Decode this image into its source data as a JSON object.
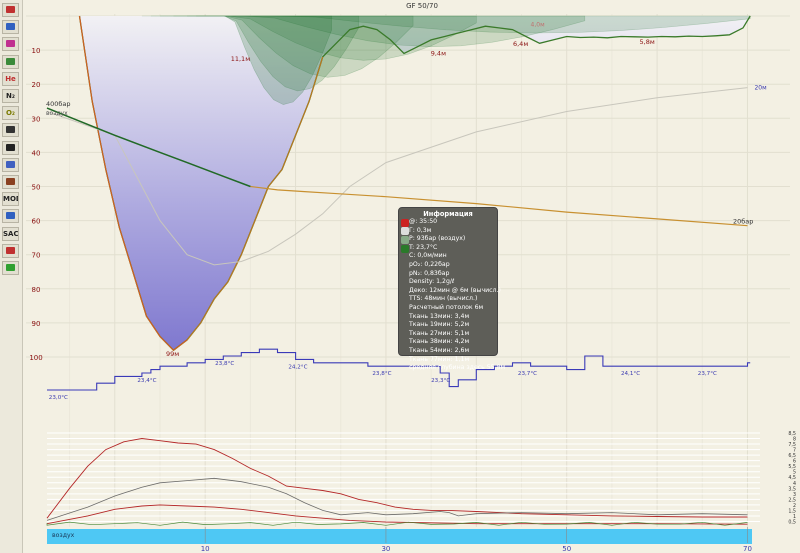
{
  "title": "GF 50/70",
  "toolbar": {
    "buttons": [
      {
        "icon": "profile-icon",
        "text": ""
      },
      {
        "icon": "ceiling-icon",
        "text": ""
      },
      {
        "icon": "ceiling-calc-icon",
        "text": ""
      },
      {
        "icon": "tissues-icon",
        "text": ""
      },
      {
        "icon": "he-icon",
        "text": "He"
      },
      {
        "icon": "n2-icon",
        "text": "N₂"
      },
      {
        "icon": "o2-icon",
        "text": "O₂"
      },
      {
        "icon": "scale-icon",
        "text": ""
      },
      {
        "icon": "heartrate-icon",
        "text": ""
      },
      {
        "icon": "ppgraph-icon",
        "text": ""
      },
      {
        "icon": "events-icon",
        "text": ""
      },
      {
        "icon": "mod-icon",
        "text": "MOD"
      },
      {
        "icon": "ead-icon",
        "text": ""
      },
      {
        "icon": "sac-icon",
        "text": "SAC"
      },
      {
        "icon": "heart-icon",
        "text": ""
      },
      {
        "icon": "color-icon",
        "text": ""
      }
    ]
  },
  "info_box": {
    "title": "Информация",
    "lines": [
      "@: 35:50",
      "Г: 0,3м",
      "P: 93бар (воздух)",
      "T: 23,7°C",
      "С: 0,0м/мин",
      "pO₂: 0,22бар",
      "pN₂: 0,83бар",
      "Density: 1,2g/ℓ",
      "Деко: 12мин @ 6м (вычисл.)",
      "TTS: 48мин (вычисл.)",
      "Расчетный потолок 6м",
      "Ткань 13мин: 3,4м",
      "Ткань 19мин: 5,2м",
      "Ткань 27мин: 5,1м",
      "Ткань 38мин: 4,2м",
      "Ткань 54мин: 2,6м",
      "Ткань 77мин: 1,1м",
      "средняя глубина здесь 55,8м"
    ]
  },
  "chart_data": {
    "type": "area",
    "title": "GF 50/70",
    "x_unit": "min",
    "xlim": [
      -7.5,
      70.5
    ],
    "x_ticks": [
      10,
      30,
      50,
      70
    ],
    "y_ticks": [
      10,
      20,
      30,
      40,
      50,
      60,
      70,
      80,
      90,
      100
    ],
    "ylim_depth_m": [
      -2,
      113
    ],
    "depth_profile": {
      "time_min": [
        -3.9,
        -2.5,
        -1,
        0.5,
        2,
        3.5,
        5,
        6.5,
        8,
        9.5,
        11,
        12.5,
        14,
        15.5,
        17,
        18.5,
        20,
        21.5,
        23,
        24.5,
        26,
        27.5,
        29,
        30.5,
        32,
        33.5,
        35,
        36.5,
        38,
        39.5,
        41,
        42.5,
        44,
        45.5,
        47,
        48.5,
        50,
        51.5,
        53,
        54.5,
        56,
        57.5,
        59,
        60.5,
        62,
        63.5,
        65,
        66.5,
        68,
        69.5,
        70.3
      ],
      "depth_m": [
        0,
        25,
        45,
        62,
        75,
        88,
        94,
        98,
        95,
        90,
        83,
        78,
        70,
        60,
        50,
        45,
        35,
        25,
        12,
        8,
        4,
        3,
        4,
        7,
        11,
        9,
        7,
        6,
        5,
        4,
        3,
        3.5,
        4,
        6,
        8,
        7,
        6,
        6.3,
        6.2,
        6.4,
        6,
        6.1,
        6.2,
        6.0,
        6.1,
        5.9,
        6.0,
        5.8,
        5.5,
        3.5,
        0
      ]
    },
    "depth_labels": [
      {
        "t": 6.4,
        "d": 98,
        "text": "99м"
      },
      {
        "t": 13.9,
        "d": 11.5,
        "text": "11,1м"
      },
      {
        "t": 35.8,
        "d": 9.8,
        "text": "9,4м"
      },
      {
        "t": 44.9,
        "d": 7,
        "text": "6,4м"
      },
      {
        "t": 58.9,
        "d": 6.5,
        "text": "5,8м"
      }
    ],
    "ceiling_note": {
      "t": 46,
      "d": 4,
      "text": "4,0м"
    },
    "pressure_start": {
      "value_bar": 400,
      "label": "400бар",
      "gas": "воздух"
    },
    "pressure_end": {
      "value_bar": 20,
      "label": "20бар"
    },
    "pressure_curve": {
      "time_min": [
        -7.5,
        0,
        5,
        8,
        12,
        15,
        18,
        21,
        24,
        30,
        40,
        50,
        60,
        70
      ],
      "depth_equiv": [
        27,
        35,
        40,
        43,
        47,
        50,
        51,
        51.5,
        52,
        53,
        55,
        57.5,
        59.5,
        61.5
      ]
    },
    "gf_line": {
      "label": "20м",
      "time_min": [
        -7.5,
        0,
        5,
        8,
        11,
        14,
        17,
        20,
        23,
        26,
        30,
        40,
        50,
        60,
        70
      ],
      "depth_equiv": [
        28,
        35,
        60,
        70,
        73,
        72,
        69,
        64,
        58,
        50,
        43,
        34,
        28,
        24,
        21
      ]
    },
    "temperature": {
      "time_min": [
        -7.5,
        -4,
        -2,
        0,
        1,
        3,
        4,
        5,
        6,
        8,
        10,
        12,
        14,
        16,
        18,
        20,
        22,
        24,
        26,
        28,
        30,
        32,
        34,
        36,
        37,
        38,
        40,
        42,
        44,
        46,
        48,
        50,
        52,
        54,
        56,
        58,
        60,
        62,
        64,
        66,
        68,
        70
      ],
      "celsius": [
        23.0,
        23.0,
        23.2,
        23.4,
        23.4,
        23.5,
        23.6,
        23.7,
        23.7,
        23.8,
        23.9,
        24.0,
        24.1,
        24.2,
        24.1,
        23.9,
        23.8,
        23.8,
        23.8,
        23.7,
        23.7,
        23.7,
        23.7,
        23.5,
        23.1,
        23.3,
        23.6,
        23.7,
        23.8,
        23.7,
        23.7,
        23.6,
        24.0,
        23.7,
        23.7,
        23.7,
        23.7,
        23.7,
        23.7,
        23.7,
        23.7,
        23.8
      ],
      "labels": [
        {
          "t": -7.3,
          "text": "23,0°C"
        },
        {
          "t": 2.5,
          "text": "23,4°C"
        },
        {
          "t": 11.1,
          "text": "23,8°C"
        },
        {
          "t": 19.2,
          "text": "24,2°C"
        },
        {
          "t": 28.5,
          "text": "23,8°C"
        },
        {
          "t": 35,
          "text": "23,3°C"
        },
        {
          "t": 44.6,
          "text": "23,7°C"
        },
        {
          "t": 56,
          "text": "24,1°C"
        },
        {
          "t": 64.5,
          "text": "23,7°C"
        }
      ]
    },
    "partial_pressures": {
      "y_ticks": [
        "0,5",
        "1",
        "1,5",
        "2",
        "2,5",
        "3",
        "3,5",
        "4",
        "4,5",
        "5",
        "5,5",
        "6",
        "6,5",
        "7",
        "7,5",
        "8",
        "8,5"
      ],
      "ylim": [
        0,
        8.5
      ],
      "series": [
        {
          "name": "pN2",
          "color": "#b42828",
          "time_min": [
            -7.5,
            -5,
            -3,
            -1,
            1,
            3,
            5,
            7,
            9,
            11,
            13,
            15,
            17,
            19,
            21,
            23,
            25,
            27,
            29,
            31,
            33,
            35,
            37,
            40,
            45,
            50,
            55,
            60,
            65,
            70
          ],
          "values": [
            0.8,
            3.5,
            5.5,
            7.0,
            7.7,
            8.0,
            7.8,
            7.6,
            7.5,
            7.0,
            6.2,
            5.3,
            4.6,
            3.7,
            3.5,
            3.3,
            3.0,
            2.5,
            2.2,
            1.8,
            1.6,
            1.5,
            1.5,
            1.4,
            1.2,
            1.1,
            1.0,
            0.95,
            0.9,
            0.9
          ]
        },
        {
          "name": "pO2",
          "color": "#b42828",
          "time_min": [
            -7.5,
            -3,
            0,
            3,
            5,
            8,
            11,
            14,
            17,
            20,
            23,
            26,
            30,
            40,
            50,
            60,
            70
          ],
          "values": [
            0.3,
            1.0,
            1.6,
            1.9,
            2.0,
            1.9,
            1.8,
            1.6,
            1.3,
            1.0,
            0.8,
            0.6,
            0.45,
            0.3,
            0.3,
            0.3,
            0.25
          ]
        },
        {
          "name": "pressure-gray",
          "color": "#555555",
          "time_min": [
            -7.5,
            -3,
            0,
            3,
            5,
            8,
            11,
            14,
            17,
            19,
            21,
            23,
            25,
            28,
            30,
            33,
            36,
            37,
            38,
            40,
            45,
            50,
            55,
            60,
            65,
            70
          ],
          "values": [
            0.6,
            1.8,
            2.8,
            3.6,
            4.0,
            4.2,
            4.4,
            4.1,
            3.6,
            3.0,
            2.2,
            1.5,
            1.1,
            1.3,
            1.1,
            1.2,
            1.4,
            1.3,
            1.0,
            1.2,
            1.3,
            1.2,
            1.3,
            1.1,
            1.2,
            1.1
          ]
        }
      ]
    },
    "gas_bar": {
      "label": "воздух",
      "color": "#4ec8f4"
    }
  }
}
